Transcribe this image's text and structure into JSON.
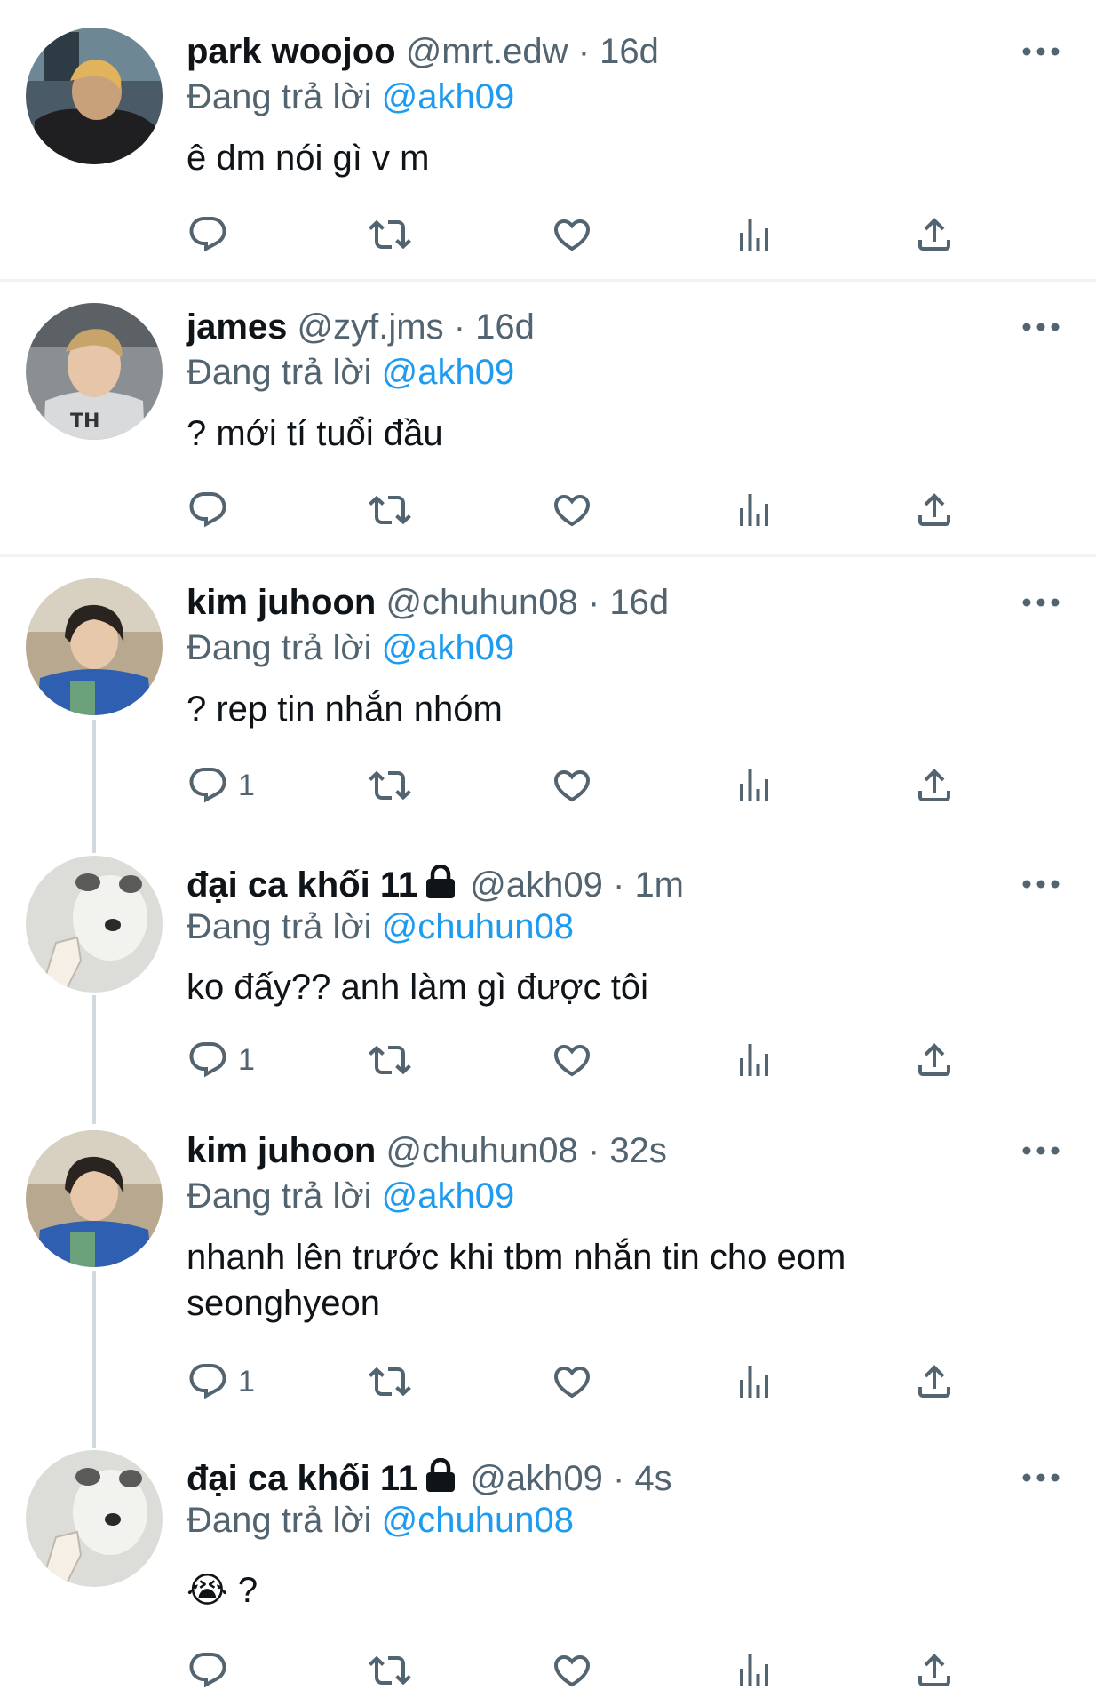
{
  "reply_prefix": "Đang trả lời",
  "tweets": [
    {
      "name": "park woojoo",
      "handle": "@mrt.edw",
      "sep": "·",
      "time": "16d",
      "replying_to": "@akh09",
      "text": "ê dm nói gì v m",
      "reply_count": ""
    },
    {
      "name": "james",
      "handle": "@zyf.jms",
      "sep": "·",
      "time": "16d",
      "replying_to": "@akh09",
      "text": "? mới tí tuổi đầu",
      "reply_count": ""
    },
    {
      "name": "kim juhoon",
      "handle": "@chuhun08",
      "sep": "·",
      "time": "16d",
      "replying_to": "@akh09",
      "text": "? rep tin nhắn nhóm",
      "reply_count": "1"
    },
    {
      "name": "đại ca khối 11",
      "handle": "@akh09",
      "sep": "·",
      "time": "1m",
      "replying_to": "@chuhun08",
      "text": "ko đấy?? anh làm gì được tôi",
      "reply_count": "1",
      "locked": true
    },
    {
      "name": "kim juhoon",
      "handle": "@chuhun08",
      "sep": "·",
      "time": "32s",
      "replying_to": "@akh09",
      "text_lines": [
        "nhanh lên trước khi tbm nhắn tin cho eom",
        "seonghyeon"
      ],
      "reply_count": "1"
    },
    {
      "name": "đại ca khối 11",
      "handle": "@akh09",
      "sep": "·",
      "time": "4s",
      "replying_to": "@chuhun08",
      "text": "?",
      "emoji": "😭",
      "reply_count": "",
      "locked": true
    }
  ],
  "icons": {
    "reply": "reply-icon",
    "retweet": "retweet-icon",
    "like": "like-icon",
    "views": "views-icon",
    "share": "share-icon",
    "more": "more-icon",
    "lock": "lock-icon"
  },
  "colors": {
    "text": "#0f1419",
    "secondary": "#536471",
    "mention": "#1d9bf0",
    "divider": "#eff3f4",
    "thread_line": "#cfd9de"
  }
}
